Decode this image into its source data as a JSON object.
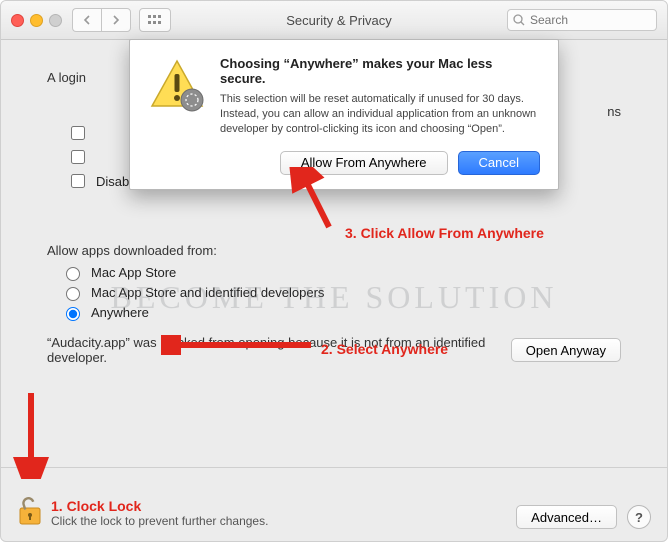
{
  "titlebar": {
    "title": "Security & Privacy",
    "search_placeholder": "Search"
  },
  "content": {
    "login_partial": "A login",
    "truncated_suffix": "ns",
    "disable_auto_login": "Disable automatic login",
    "allow_label": "Allow apps downloaded from:",
    "radio1": "Mac App Store",
    "radio2": "Mac App Store and identified developers",
    "radio3": "Anywhere",
    "blocked_text": "“Audacity.app” was blocked from opening because it is not from an identified developer.",
    "open_anyway": "Open Anyway"
  },
  "dialog": {
    "title": "Choosing “Anywhere” makes your Mac less secure.",
    "body": "This selection will be reset automatically if unused for 30 days. Instead, you can allow an individual application from an unknown developer by control-clicking its icon and choosing “Open”.",
    "allow_btn": "Allow From Anywhere",
    "cancel_btn": "Cancel"
  },
  "bottom": {
    "lock_text": "Click the lock to prevent further changes.",
    "advanced": "Advanced…",
    "help": "?"
  },
  "annotations": {
    "a1": "1. Clock Lock",
    "a2": "2. Select Anywhere",
    "a3": "3. Click Allow From Anywhere"
  },
  "watermark": "BECOME THE SOLUTION"
}
